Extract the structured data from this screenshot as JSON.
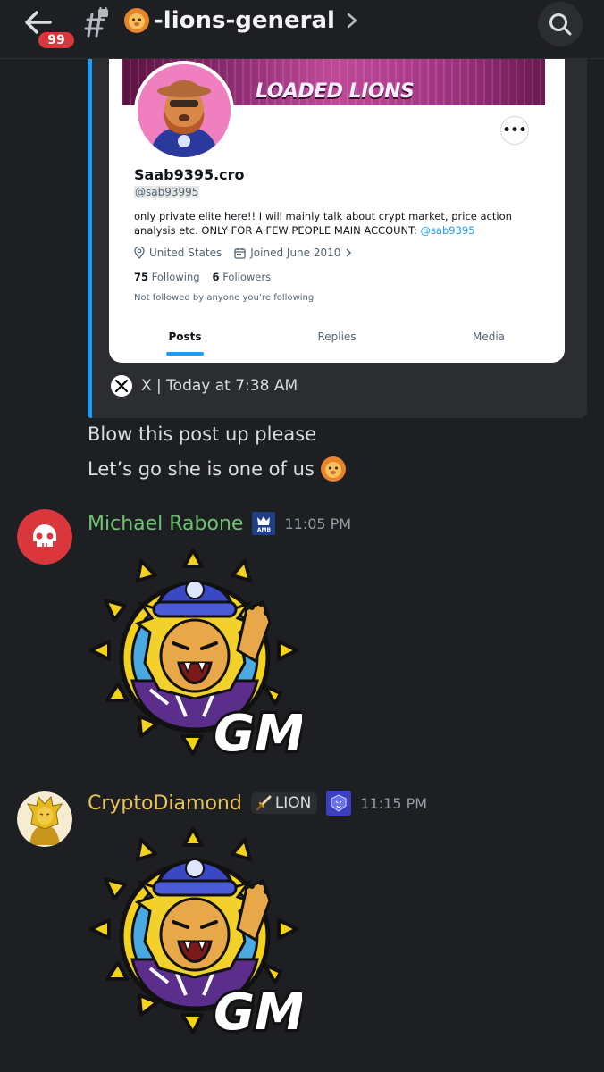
{
  "header": {
    "badge_count": "99",
    "channel_name": "-lions-general"
  },
  "embed": {
    "accent_color": "#1d9bf0",
    "banner_text": "LOADED LIONS",
    "profile": {
      "display_name": "Saab9395.cro",
      "handle": "@sab93995",
      "bio": "only private elite here!! I will mainly talk about crypt market, price action analysis etc. ONLY FOR A FEW PEOPLE MAIN ACCOUNT: ",
      "bio_mention": "@sab9395",
      "location": "United States",
      "joined": "Joined June 2010",
      "following_count": "75",
      "following_label": "Following",
      "followers_count": "6",
      "followers_label": "Followers",
      "not_followed": "Not followed by anyone you’re following",
      "tabs": [
        "Posts",
        "Replies",
        "Media"
      ],
      "active_tab": "Posts"
    },
    "footer": "X | Today at 7:38 AM"
  },
  "messages": [
    {
      "lines": [
        "Blow this post up please",
        "Let’s go she is one of us"
      ]
    },
    {
      "username": "Michael Rabone",
      "username_color": "#6cc46f",
      "badge": "AMB",
      "time": "11:05 PM",
      "sticker_text": "GM"
    },
    {
      "username": "CryptoDiamond",
      "username_color": "#e8c35a",
      "role": "LION",
      "time": "11:15 PM",
      "sticker_text": "GM"
    }
  ]
}
